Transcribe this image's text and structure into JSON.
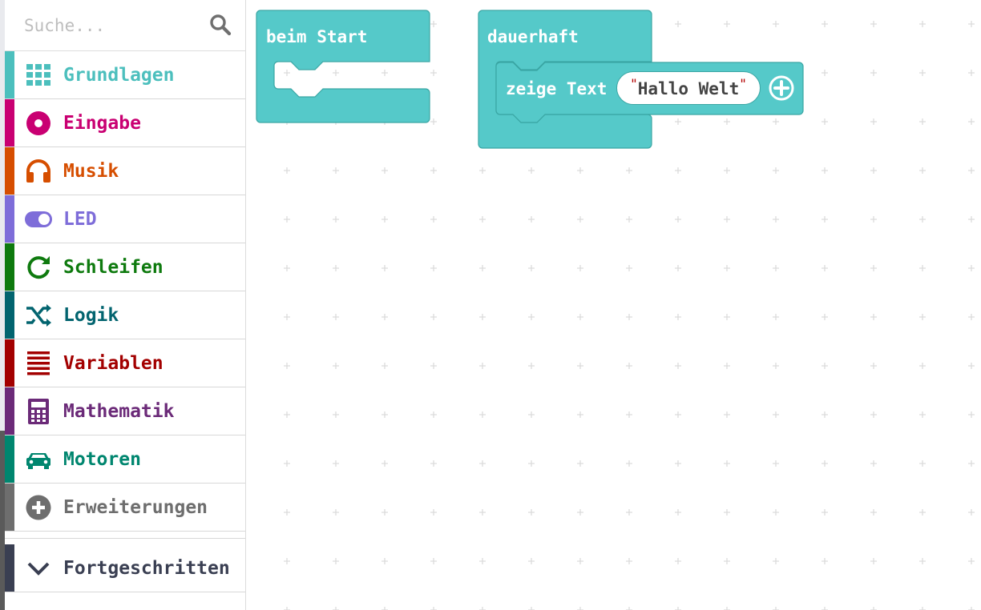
{
  "search": {
    "placeholder": "Suche...",
    "icon": "search-icon"
  },
  "categories": [
    {
      "label": "Grundlagen",
      "color": "#4cbfbd",
      "icon": "grid-icon"
    },
    {
      "label": "Eingabe",
      "color": "#c90072",
      "icon": "target-circle-icon"
    },
    {
      "label": "Musik",
      "color": "#d64e00",
      "icon": "headphones-icon"
    },
    {
      "label": "LED",
      "color": "#7e6dd9",
      "icon": "toggle-icon"
    },
    {
      "label": "Schleifen",
      "color": "#0e7a0e",
      "icon": "refresh-loop-icon"
    },
    {
      "label": "Logik",
      "color": "#02646f",
      "icon": "shuffle-icon"
    },
    {
      "label": "Variablen",
      "color": "#a30000",
      "icon": "list-lines-icon"
    },
    {
      "label": "Mathematik",
      "color": "#6b2a78",
      "icon": "calculator-icon"
    },
    {
      "label": "Motoren",
      "color": "#00866f",
      "icon": "car-icon"
    },
    {
      "label": "Erweiterungen",
      "color": "#6e6e6e",
      "icon": "plus-circle-icon"
    }
  ],
  "advanced": {
    "label": "Fortgeschritten",
    "color": "#3a3f52",
    "icon": "chevron-down-icon"
  },
  "blocks": {
    "on_start": {
      "label": "beim Start",
      "color": "#55c9c9"
    },
    "forever": {
      "label": "dauerhaft",
      "color": "#55c9c9"
    },
    "show_string": {
      "label": "zeige Text",
      "value": "Hallo Welt",
      "quote": "\"",
      "add_icon": "plus-circle-icon"
    }
  }
}
